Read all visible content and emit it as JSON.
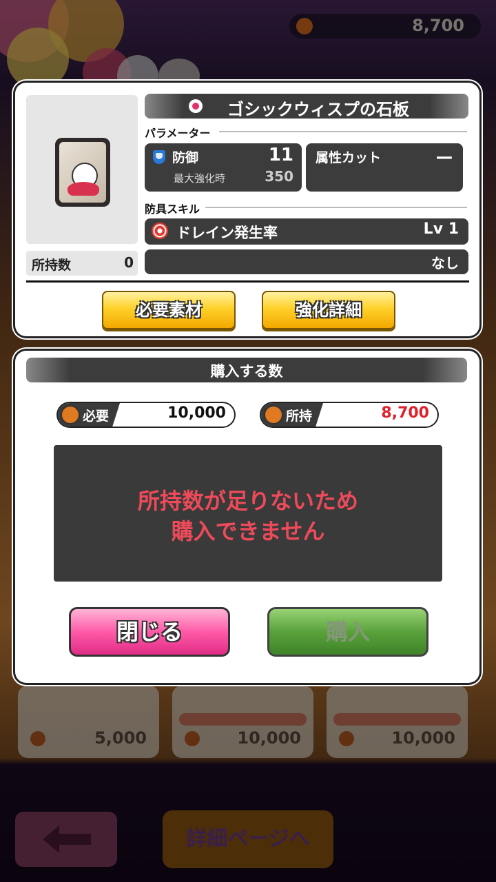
{
  "header": {
    "currency_value": "8,700"
  },
  "item": {
    "name": "ゴシックウィスプの石板",
    "owned_label": "所持数",
    "owned_value": "0"
  },
  "params": {
    "section_label": "パラメーター",
    "defense_label": "防御",
    "defense_value": "11",
    "max_label": "最大強化時",
    "max_value": "350",
    "attr_cut_label": "属性カット",
    "attr_cut_value": "ー"
  },
  "skill": {
    "section_label": "防具スキル",
    "name": "ドレイン発生率",
    "level": "Lv 1",
    "second": "なし"
  },
  "buttons": {
    "materials": "必要素材",
    "enhance_detail": "強化詳細",
    "close": "閉じる",
    "buy": "購入"
  },
  "purchase": {
    "title": "購入する数",
    "need_label": "必要",
    "need_value": "10,000",
    "own_label": "所持",
    "own_value": "8,700",
    "message_line1": "所持数が足りないため",
    "message_line2": "購入できません"
  },
  "background": {
    "cards": [
      {
        "price": "5,000"
      },
      {
        "price": "10,000"
      },
      {
        "price": "10,000"
      }
    ],
    "detail_page_button": "詳細ページへ"
  },
  "colors": {
    "shortage_red": "#e0202a",
    "message_red": "#ef4a5a"
  }
}
